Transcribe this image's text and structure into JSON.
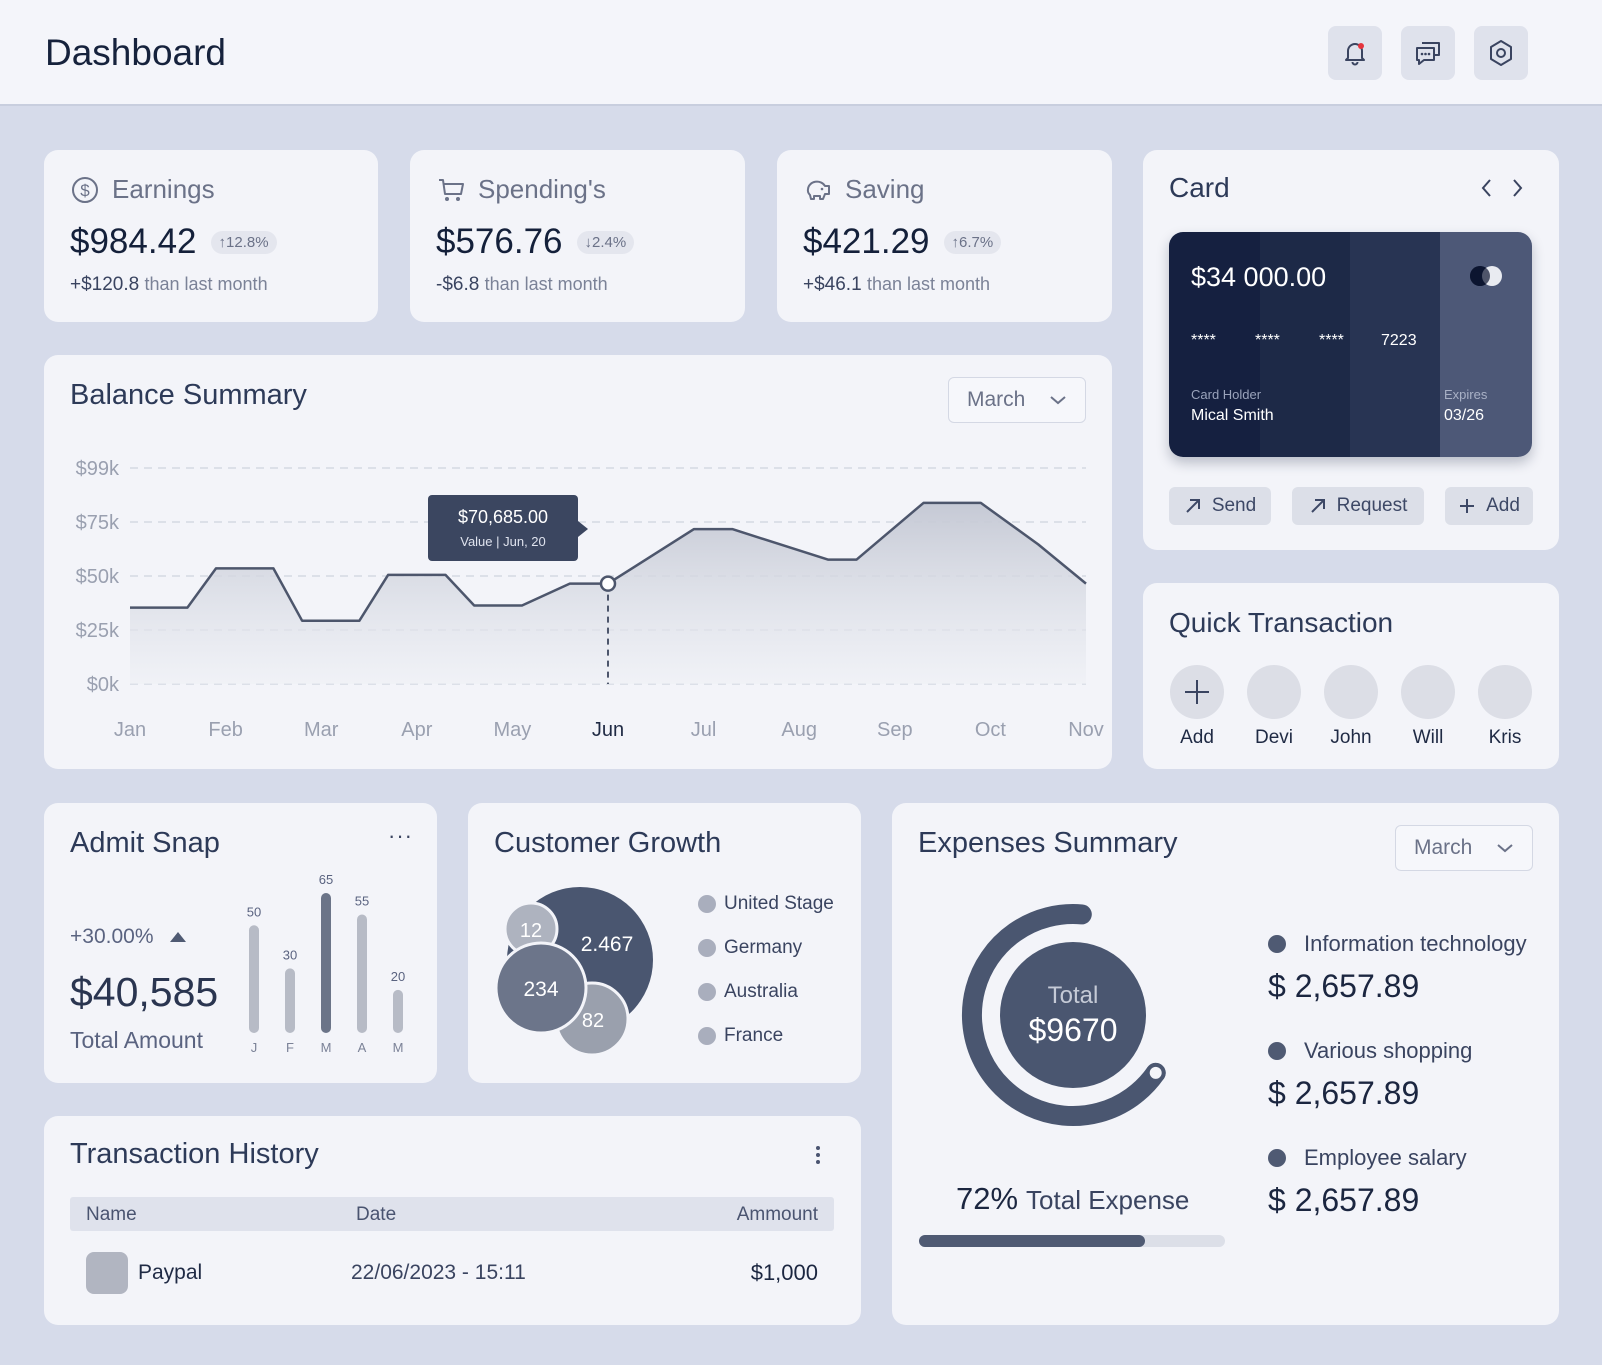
{
  "header": {
    "title": "Dashboard",
    "icons": [
      "bell-icon",
      "chat-icon",
      "settings-icon"
    ],
    "notification_color": "#e5343d"
  },
  "stats": [
    {
      "label": "Earnings",
      "icon": "dollar-circle-icon",
      "value": "$984.42",
      "badge": "↑12.8%",
      "change": "+$120.8",
      "change_text": "than last month"
    },
    {
      "label": "Spending's",
      "icon": "cart-icon",
      "value": "$576.76",
      "badge": "↓2.4%",
      "change": "-$6.8",
      "change_text": "than last month"
    },
    {
      "label": "Saving",
      "icon": "piggy-bank-icon",
      "value": "$421.29",
      "badge": "↑6.7%",
      "change": "+$46.1",
      "change_text": "than last month"
    }
  ],
  "balance": {
    "title": "Balance Summary",
    "dropdown": "March",
    "tooltip_value": "$70,685.00",
    "tooltip_label": "Value | Jun, 20",
    "chart_data": {
      "type": "area",
      "yticks": [
        "$99k",
        "$75k",
        "$50k",
        "$25k",
        "$0k"
      ],
      "xticks": [
        "Jan",
        "Feb",
        "Mar",
        "Apr",
        "May",
        "Jun",
        "Jul",
        "Aug",
        "Sep",
        "Oct",
        "Nov"
      ],
      "highlight": "Jun",
      "ylim": [
        0,
        99
      ],
      "x": [
        0,
        0.6,
        0.9,
        1.5,
        1.8,
        2.4,
        2.7,
        3.3,
        3.6,
        4.1,
        4.6,
        5.0,
        5.9,
        6.3,
        7.3,
        7.6,
        8.3,
        8.9,
        9.5,
        10.0
      ],
      "values": [
        35,
        35,
        53,
        53,
        29,
        29,
        50,
        50,
        36,
        36,
        46,
        46,
        71,
        71,
        57,
        57,
        83,
        83,
        64,
        46
      ],
      "grid": true
    }
  },
  "card": {
    "title": "Card",
    "balance": "$34 000.00",
    "groups": [
      "****",
      "****",
      "****",
      "7223"
    ],
    "holder_label": "Card Holder",
    "holder": "Mical Smith",
    "expires_label": "Expires",
    "expires": "03/26",
    "actions": [
      "Send",
      "Request",
      "Add"
    ]
  },
  "quick": {
    "title": "Quick Transaction",
    "contacts": [
      "Add",
      "Devi",
      "John",
      "Will",
      "Kris"
    ]
  },
  "admit": {
    "title": "Admit Snap",
    "percent": "+30.00%",
    "amount": "$40,585",
    "amount_label": "Total Amount",
    "chart_data": {
      "type": "bar",
      "categories": [
        "J",
        "F",
        "M",
        "A",
        "M"
      ],
      "values": [
        50,
        30,
        65,
        55,
        20
      ],
      "highlight_index": 2
    }
  },
  "growth": {
    "title": "Customer Growth",
    "bubbles": [
      "2.467",
      "12",
      "234",
      "82"
    ],
    "legend": [
      "United Stage",
      "Germany",
      "Australia",
      "France"
    ]
  },
  "expenses": {
    "title": "Expenses Summary",
    "dropdown": "March",
    "total_label": "Total",
    "total": "$9670",
    "percent": "72%",
    "percent_label": "Total Expense",
    "progress": 0.74,
    "categories": [
      {
        "name": "Information technology",
        "amount": "$ 2,657.89"
      },
      {
        "name": "Various shopping",
        "amount": "$ 2,657.89"
      },
      {
        "name": "Employee salary",
        "amount": "$ 2,657.89"
      }
    ]
  },
  "history": {
    "title": "Transaction History",
    "columns": [
      "Name",
      "Date",
      "Ammount"
    ],
    "rows": [
      {
        "name": "Paypal",
        "date": "22/06/2023 - 15:11",
        "amount": "$1,000"
      }
    ]
  }
}
